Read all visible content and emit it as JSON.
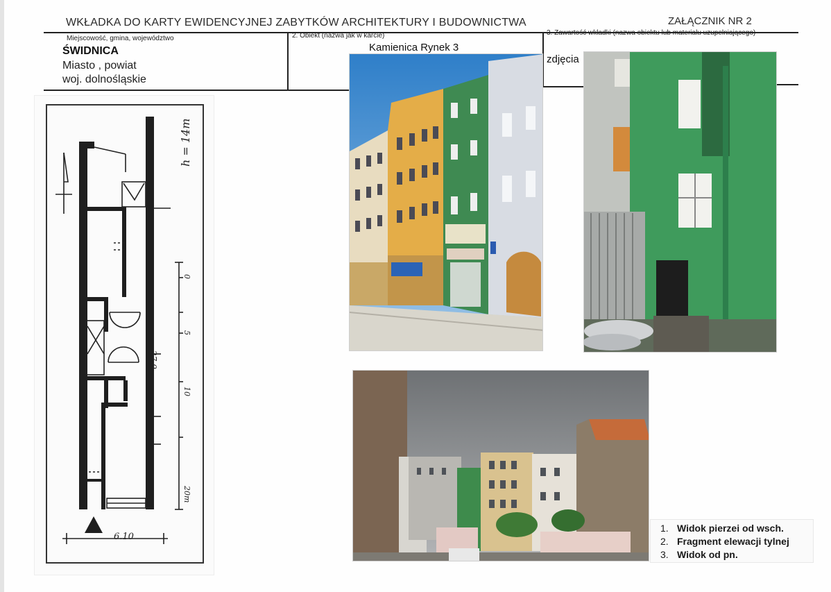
{
  "header": {
    "title": "WKŁADKA DO KARTY EWIDENCYJNEJ ZABYTKÓW ARCHITEKTURY I BUDOWNICTWA",
    "annex": "ZAŁĄCZNIK NR 2"
  },
  "fields": {
    "location": {
      "label": "Miejscowość, gmina, województwo",
      "town": "ŚWIDNICA",
      "district": "Miasto , powiat",
      "province": "woj. dolnośląskie"
    },
    "object": {
      "label": "2. Obiekt (nazwa jak w karcie)",
      "value": "Kamienica Rynek 3"
    },
    "contents": {
      "label": "3. Zawartość wkładki (nazwa obiektu lub materiału uzupełniającego)",
      "value": "zdjęcia"
    }
  },
  "plan": {
    "height_note": "h = 14m",
    "width_dim": "6.10",
    "length_dim": "27.0",
    "scale_ticks": [
      "0",
      "5",
      "10",
      "20m"
    ]
  },
  "captions": [
    {
      "num": "1.",
      "text": "Widok pierzei od wsch."
    },
    {
      "num": "2.",
      "text": "Fragment elewacji tylnej"
    },
    {
      "num": "3.",
      "text": "Widok od pn."
    }
  ],
  "colors": {
    "frame_line": "#222222",
    "facade_green": "#3f8a52",
    "facade_yellow": "#e2b24a",
    "sky_blue": "#3f8ed0",
    "overcast_sky": "#8e9194"
  }
}
